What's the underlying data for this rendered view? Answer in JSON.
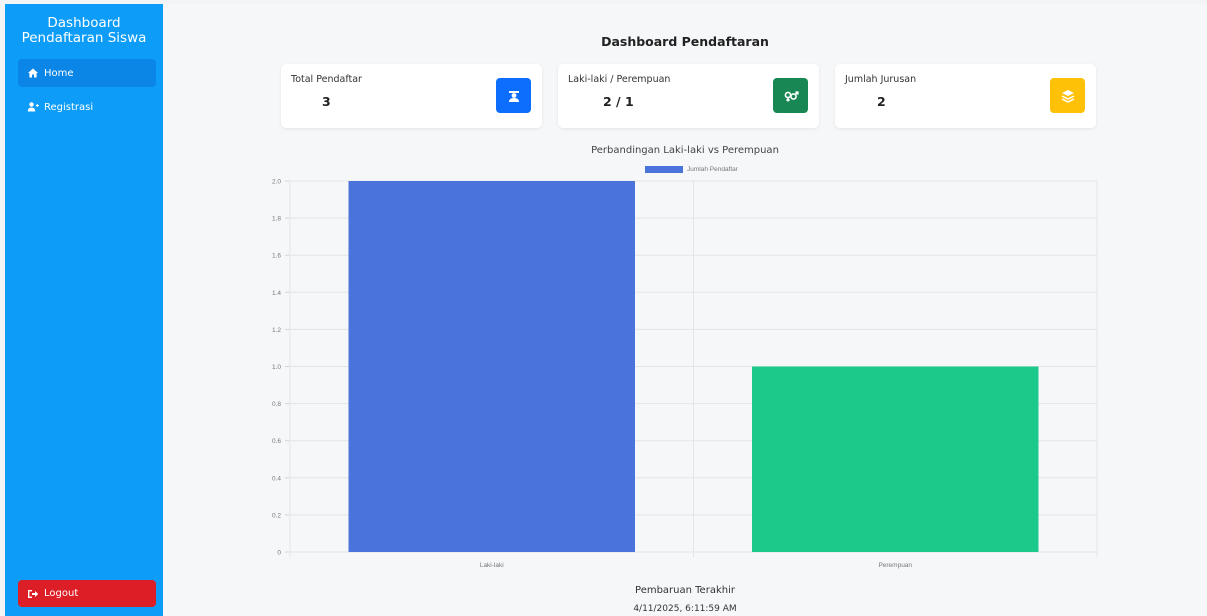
{
  "sidebar": {
    "brand_line1": "Dashboard",
    "brand_line2": "Pendaftaran Siswa",
    "items": [
      {
        "label": "Home",
        "icon": "home-icon",
        "active": true
      },
      {
        "label": "Registrasi",
        "icon": "user-plus-icon",
        "active": false
      }
    ],
    "logout_label": "Logout"
  },
  "header": {
    "title": "Dashboard Pendaftaran"
  },
  "cards": [
    {
      "label": "Total Pendaftar",
      "value": "3",
      "icon": "graduate-icon",
      "color": "#0d6efd"
    },
    {
      "label": "Laki-laki / Perempuan",
      "value": "2 / 1",
      "icon": "gender-icon",
      "color": "#198754"
    },
    {
      "label": "Jumlah Jurusan",
      "value": "2",
      "icon": "layers-icon",
      "color": "#ffc107"
    }
  ],
  "chart_data": {
    "type": "bar",
    "title": "Perbandingan Laki-laki vs Perempuan",
    "categories": [
      "Laki-laki",
      "Perempuan"
    ],
    "series": [
      {
        "name": "Jumlah Pendaftar",
        "values": [
          2,
          1
        ]
      }
    ],
    "bar_colors": [
      "#4a74dc",
      "#1cc88a"
    ],
    "ylim": [
      0,
      2
    ],
    "yticks": [
      "2.0",
      "1.8",
      "1.6",
      "1.4",
      "1.2",
      "1.0",
      "0.8",
      "0.6",
      "0.4",
      "0.2",
      "0"
    ],
    "legend": "top",
    "grid": true
  },
  "footer": {
    "update_label": "Pembaruan Terakhir",
    "update_value": "4/11/2025, 6:11:59 AM"
  }
}
